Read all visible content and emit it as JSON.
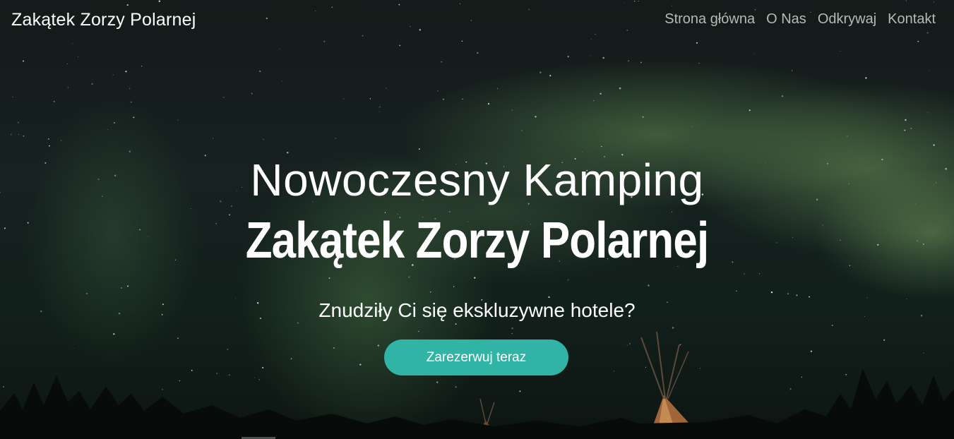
{
  "brand": {
    "title": "Zakątek Zorzy Polarnej"
  },
  "nav": {
    "items": [
      {
        "label": "Strona główna"
      },
      {
        "label": "O Nas"
      },
      {
        "label": "Odkrywaj"
      },
      {
        "label": "Kontakt"
      }
    ]
  },
  "hero": {
    "heading_line1": "Nowoczesny Kamping",
    "heading_line2": "Zakątek Zorzy Polarnej",
    "tagline": "Znudziły Ci się ekskluzywne hotele?",
    "cta_label": "Zarezerwuj teraz"
  },
  "colors": {
    "accent": "#31b4a6",
    "nav_text": "#b4bab7",
    "text": "#ffffff"
  }
}
